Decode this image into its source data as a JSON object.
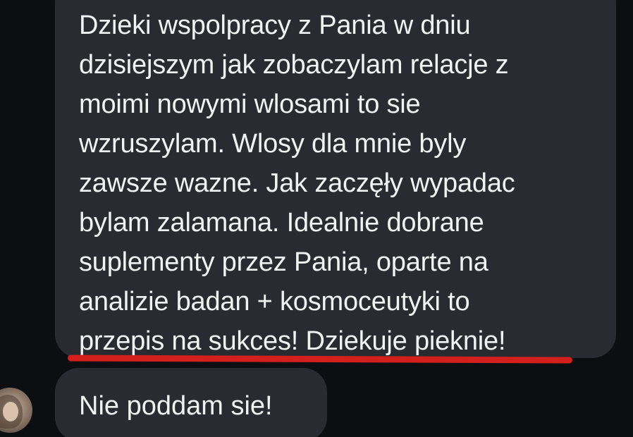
{
  "conversation": {
    "messages": [
      {
        "text": "Dzieki wspolpracy z Pania w dniu\ndzisiejszym jak zobaczylam relacje z\nmoimi nowymi wlosami to sie\nwzruszylam. Wlosy dla mnie byly\nzawsze wazne. Jak zaczęły wypadac\nbylam zalamana. Idealnie dobrane\nsuplementy przez Pania, oparte na\nanalizie badan + kosmoceutyki to\nprzepis na sukces! Dziekuje pieknie!"
      },
      {
        "text": "Nie poddam sie!"
      }
    ]
  },
  "colors": {
    "background": "#0d0e12",
    "bubble": "#2a2b30",
    "text": "#f2f2f2",
    "underline": "#d3201c"
  }
}
